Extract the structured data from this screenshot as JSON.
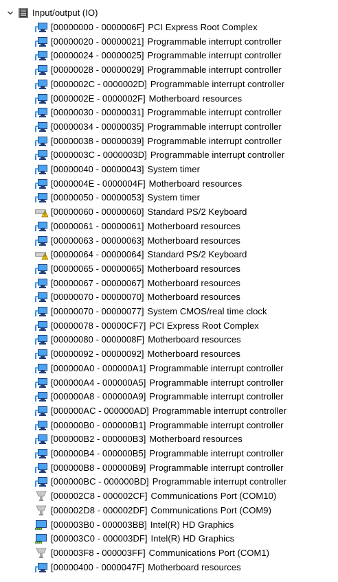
{
  "root": {
    "label": "Input/output (IO)",
    "icon": "io-category-icon",
    "expanded": true
  },
  "items": [
    {
      "range": "[00000000 - 0000006F]",
      "name": "PCI Express Root Complex",
      "icon": "system-device-icon"
    },
    {
      "range": "[00000020 - 00000021]",
      "name": "Programmable interrupt controller",
      "icon": "system-device-icon"
    },
    {
      "range": "[00000024 - 00000025]",
      "name": "Programmable interrupt controller",
      "icon": "system-device-icon"
    },
    {
      "range": "[00000028 - 00000029]",
      "name": "Programmable interrupt controller",
      "icon": "system-device-icon"
    },
    {
      "range": "[0000002C - 0000002D]",
      "name": "Programmable interrupt controller",
      "icon": "system-device-icon"
    },
    {
      "range": "[0000002E - 0000002F]",
      "name": "Motherboard resources",
      "icon": "system-device-icon"
    },
    {
      "range": "[00000030 - 00000031]",
      "name": "Programmable interrupt controller",
      "icon": "system-device-icon"
    },
    {
      "range": "[00000034 - 00000035]",
      "name": "Programmable interrupt controller",
      "icon": "system-device-icon"
    },
    {
      "range": "[00000038 - 00000039]",
      "name": "Programmable interrupt controller",
      "icon": "system-device-icon"
    },
    {
      "range": "[0000003C - 0000003D]",
      "name": "Programmable interrupt controller",
      "icon": "system-device-icon"
    },
    {
      "range": "[00000040 - 00000043]",
      "name": "System timer",
      "icon": "system-device-icon"
    },
    {
      "range": "[0000004E - 0000004F]",
      "name": "Motherboard resources",
      "icon": "system-device-icon"
    },
    {
      "range": "[00000050 - 00000053]",
      "name": "System timer",
      "icon": "system-device-icon"
    },
    {
      "range": "[00000060 - 00000060]",
      "name": "Standard PS/2 Keyboard",
      "icon": "keyboard-warning-icon"
    },
    {
      "range": "[00000061 - 00000061]",
      "name": "Motherboard resources",
      "icon": "system-device-icon"
    },
    {
      "range": "[00000063 - 00000063]",
      "name": "Motherboard resources",
      "icon": "system-device-icon"
    },
    {
      "range": "[00000064 - 00000064]",
      "name": "Standard PS/2 Keyboard",
      "icon": "keyboard-warning-icon"
    },
    {
      "range": "[00000065 - 00000065]",
      "name": "Motherboard resources",
      "icon": "system-device-icon"
    },
    {
      "range": "[00000067 - 00000067]",
      "name": "Motherboard resources",
      "icon": "system-device-icon"
    },
    {
      "range": "[00000070 - 00000070]",
      "name": "Motherboard resources",
      "icon": "system-device-icon"
    },
    {
      "range": "[00000070 - 00000077]",
      "name": "System CMOS/real time clock",
      "icon": "system-device-icon"
    },
    {
      "range": "[00000078 - 00000CF7]",
      "name": "PCI Express Root Complex",
      "icon": "system-device-icon"
    },
    {
      "range": "[00000080 - 0000008F]",
      "name": "Motherboard resources",
      "icon": "system-device-icon"
    },
    {
      "range": "[00000092 - 00000092]",
      "name": "Motherboard resources",
      "icon": "system-device-icon"
    },
    {
      "range": "[000000A0 - 000000A1]",
      "name": "Programmable interrupt controller",
      "icon": "system-device-icon"
    },
    {
      "range": "[000000A4 - 000000A5]",
      "name": "Programmable interrupt controller",
      "icon": "system-device-icon"
    },
    {
      "range": "[000000A8 - 000000A9]",
      "name": "Programmable interrupt controller",
      "icon": "system-device-icon"
    },
    {
      "range": "[000000AC - 000000AD]",
      "name": "Programmable interrupt controller",
      "icon": "system-device-icon"
    },
    {
      "range": "[000000B0 - 000000B1]",
      "name": "Programmable interrupt controller",
      "icon": "system-device-icon"
    },
    {
      "range": "[000000B2 - 000000B3]",
      "name": "Motherboard resources",
      "icon": "system-device-icon"
    },
    {
      "range": "[000000B4 - 000000B5]",
      "name": "Programmable interrupt controller",
      "icon": "system-device-icon"
    },
    {
      "range": "[000000B8 - 000000B9]",
      "name": "Programmable interrupt controller",
      "icon": "system-device-icon"
    },
    {
      "range": "[000000BC - 000000BD]",
      "name": "Programmable interrupt controller",
      "icon": "system-device-icon"
    },
    {
      "range": "[000002C8 - 000002CF]",
      "name": "Communications Port (COM10)",
      "icon": "com-port-icon"
    },
    {
      "range": "[000002D8 - 000002DF]",
      "name": "Communications Port (COM9)",
      "icon": "com-port-icon"
    },
    {
      "range": "[000003B0 - 000003BB]",
      "name": "Intel(R) HD Graphics",
      "icon": "display-adapter-icon"
    },
    {
      "range": "[000003C0 - 000003DF]",
      "name": "Intel(R) HD Graphics",
      "icon": "display-adapter-icon"
    },
    {
      "range": "[000003F8 - 000003FF]",
      "name": "Communications Port (COM1)",
      "icon": "com-port-icon"
    },
    {
      "range": "[00000400 - 0000047F]",
      "name": "Motherboard resources",
      "icon": "system-device-icon"
    }
  ]
}
